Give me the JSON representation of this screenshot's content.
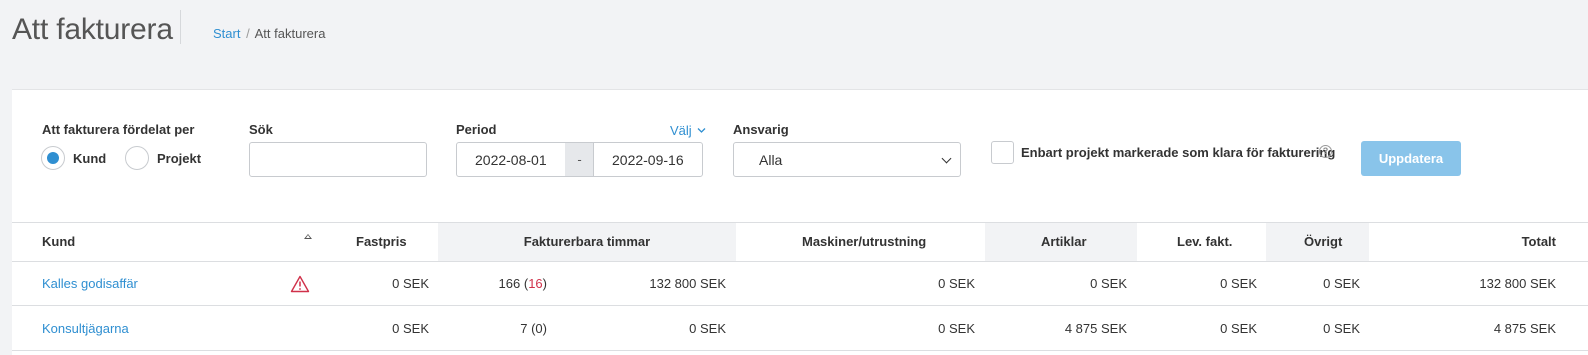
{
  "page": {
    "title": "Att fakturera",
    "breadcrumb": {
      "start": "Start",
      "separator": "/",
      "current": "Att fakturera"
    }
  },
  "filters": {
    "distribution_label": "Att fakturera fördelat per",
    "radio_kund": "Kund",
    "radio_projekt": "Projekt",
    "selected": "Kund",
    "search_label": "Sök",
    "search_value": "",
    "period_label": "Period",
    "valj_label": "Välj",
    "date_from": "2022-08-01",
    "date_separator": "-",
    "date_to": "2022-09-16",
    "ansvarig_label": "Ansvarig",
    "ansvarig_value": "Alla",
    "ready_checkbox_label": "Enbart projekt markerade som klara för fakturering",
    "ready_checked": false,
    "help_glyph": "?",
    "update_button": "Uppdatera"
  },
  "table": {
    "headers": {
      "kund": "Kund",
      "fastpris": "Fastpris",
      "fakturerbara": "Fakturerbara timmar",
      "maskiner": "Maskiner/utrustning",
      "artiklar": "Artiklar",
      "lev": "Lev. fakt.",
      "ovrigt": "Övrigt",
      "totalt": "Totalt"
    },
    "rows": [
      {
        "kund": "Kalles godisaffär",
        "warning": true,
        "fastpris": "0 SEK",
        "hours": "166",
        "hours_open": "(",
        "hours_extra": "16",
        "hours_close": ")",
        "hours_amount": "132 800 SEK",
        "maskiner": "0 SEK",
        "artiklar": "0 SEK",
        "lev": "0 SEK",
        "ovrigt": "0 SEK",
        "totalt": "132 800 SEK"
      },
      {
        "kund": "Konsultjägarna",
        "warning": false,
        "fastpris": "0 SEK",
        "hours": "7",
        "hours_open": "(",
        "hours_extra": "0",
        "hours_close": ")",
        "hours_amount": "0 SEK",
        "maskiner": "0 SEK",
        "artiklar": "4 875 SEK",
        "lev": "0 SEK",
        "ovrigt": "0 SEK",
        "totalt": "4 875 SEK"
      }
    ]
  },
  "colors": {
    "accent": "#2f8fd1",
    "button": "#89c4ea",
    "warning": "#d0314a"
  }
}
